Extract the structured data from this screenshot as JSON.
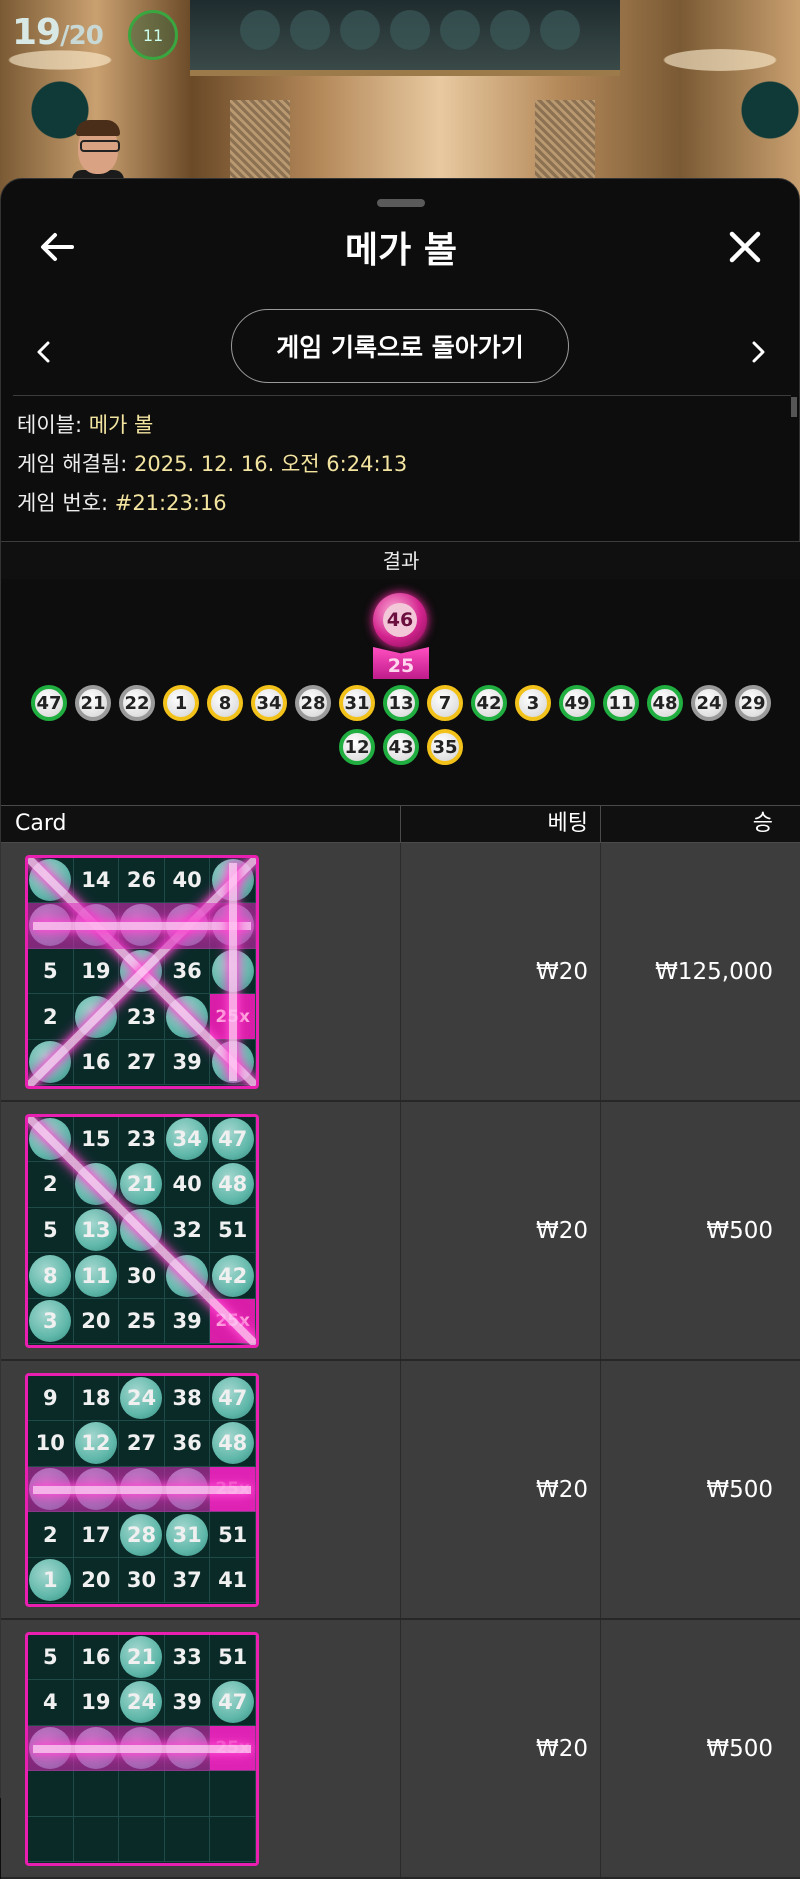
{
  "video": {
    "round_counter": "19",
    "round_total": "/20",
    "ring_value": "11"
  },
  "header": {
    "title": "메가 볼",
    "back_icon": "arrow-left-icon",
    "close_icon": "close-icon"
  },
  "nav": {
    "history_button": "게임 기록으로 돌아가기",
    "prev_icon": "chevron-left-icon",
    "next_icon": "chevron-right-icon"
  },
  "info": {
    "table_label": "테이블: ",
    "table_value": "메가 볼",
    "resolved_label": "게임 해결됨: ",
    "resolved_value": "2025. 12. 16. 오전 6:24:13",
    "game_no_label": "게임 번호: ",
    "game_no_value": "#21:23:16"
  },
  "result": {
    "header": "결과",
    "mega_ball": "46",
    "multiplier": "25",
    "balls": [
      {
        "n": "47",
        "c": "green"
      },
      {
        "n": "21",
        "c": "gray"
      },
      {
        "n": "22",
        "c": "gray"
      },
      {
        "n": "1",
        "c": "yellow"
      },
      {
        "n": "8",
        "c": "yellow"
      },
      {
        "n": "34",
        "c": "yellow"
      },
      {
        "n": "28",
        "c": "gray"
      },
      {
        "n": "31",
        "c": "yellow"
      },
      {
        "n": "13",
        "c": "green"
      },
      {
        "n": "7",
        "c": "yellow"
      },
      {
        "n": "42",
        "c": "green"
      },
      {
        "n": "3",
        "c": "yellow"
      },
      {
        "n": "49",
        "c": "green"
      },
      {
        "n": "11",
        "c": "green"
      },
      {
        "n": "48",
        "c": "green"
      },
      {
        "n": "24",
        "c": "gray"
      },
      {
        "n": "29",
        "c": "gray"
      },
      {
        "n": "12",
        "c": "green"
      },
      {
        "n": "43",
        "c": "green"
      },
      {
        "n": "35",
        "c": "yellow"
      }
    ]
  },
  "table": {
    "col_card": "Card",
    "col_bet": "베팅",
    "col_win": "승",
    "rows": [
      {
        "bet": "₩20",
        "win": "₩125,000",
        "cells": [
          {
            "n": "",
            "hit": true
          },
          {
            "n": "14"
          },
          {
            "n": "26"
          },
          {
            "n": "40"
          },
          {
            "n": "",
            "hit": true
          },
          {
            "n": "",
            "hit": true
          },
          {
            "n": "",
            "hit": true
          },
          {
            "n": "",
            "hit": true
          },
          {
            "n": "",
            "hit": true
          },
          {
            "n": "",
            "hit": true
          },
          {
            "n": "5"
          },
          {
            "n": "19"
          },
          {
            "n": "",
            "hit": true
          },
          {
            "n": "36"
          },
          {
            "n": "",
            "hit": true
          },
          {
            "n": "2"
          },
          {
            "n": "",
            "hit": true
          },
          {
            "n": "23"
          },
          {
            "n": "",
            "hit": true
          },
          {
            "n": "25x",
            "mega": true
          },
          {
            "n": "",
            "hit": true
          },
          {
            "n": "16"
          },
          {
            "n": "27"
          },
          {
            "n": "39"
          },
          {
            "n": "",
            "hit": true
          }
        ],
        "lines": [
          "diag1",
          "diag2",
          "row2",
          "col5"
        ]
      },
      {
        "bet": "₩20",
        "win": "₩500",
        "cells": [
          {
            "n": "",
            "hit": true
          },
          {
            "n": "15"
          },
          {
            "n": "23"
          },
          {
            "n": "34",
            "hit": true
          },
          {
            "n": "47",
            "hit": true
          },
          {
            "n": "2"
          },
          {
            "n": "",
            "hit": true
          },
          {
            "n": "21",
            "hit": true
          },
          {
            "n": "40"
          },
          {
            "n": "48",
            "hit": true
          },
          {
            "n": "5"
          },
          {
            "n": "13",
            "hit": true
          },
          {
            "n": "",
            "hit": true
          },
          {
            "n": "32"
          },
          {
            "n": "51"
          },
          {
            "n": "8",
            "hit": true
          },
          {
            "n": "11",
            "hit": true
          },
          {
            "n": "30"
          },
          {
            "n": "",
            "hit": true
          },
          {
            "n": "42",
            "hit": true
          },
          {
            "n": "3",
            "hit": true
          },
          {
            "n": "20"
          },
          {
            "n": "25"
          },
          {
            "n": "39"
          },
          {
            "n": "25x",
            "mega": true
          }
        ],
        "lines": [
          "diag1"
        ]
      },
      {
        "bet": "₩20",
        "win": "₩500",
        "cells": [
          {
            "n": "9"
          },
          {
            "n": "18"
          },
          {
            "n": "24",
            "hit": true
          },
          {
            "n": "38"
          },
          {
            "n": "47",
            "hit": true
          },
          {
            "n": "10"
          },
          {
            "n": "12",
            "hit": true
          },
          {
            "n": "27"
          },
          {
            "n": "36"
          },
          {
            "n": "48",
            "hit": true
          },
          {
            "n": "",
            "hit": true
          },
          {
            "n": "",
            "hit": true
          },
          {
            "n": "",
            "hit": true
          },
          {
            "n": "",
            "hit": true
          },
          {
            "n": "25x",
            "mega": true
          },
          {
            "n": "2"
          },
          {
            "n": "17"
          },
          {
            "n": "28",
            "hit": true
          },
          {
            "n": "31",
            "hit": true
          },
          {
            "n": "51"
          },
          {
            "n": "1",
            "hit": true
          },
          {
            "n": "20"
          },
          {
            "n": "30"
          },
          {
            "n": "37"
          },
          {
            "n": "41"
          }
        ],
        "lines": [
          "row3"
        ]
      },
      {
        "bet": "₩20",
        "win": "₩500",
        "cells": [
          {
            "n": "5"
          },
          {
            "n": "16"
          },
          {
            "n": "21",
            "hit": true
          },
          {
            "n": "33"
          },
          {
            "n": "51"
          },
          {
            "n": "4"
          },
          {
            "n": "19"
          },
          {
            "n": "24",
            "hit": true
          },
          {
            "n": "39"
          },
          {
            "n": "47",
            "hit": true
          },
          {
            "n": "",
            "hit": true
          },
          {
            "n": "",
            "hit": true
          },
          {
            "n": "",
            "hit": true
          },
          {
            "n": "",
            "hit": true
          },
          {
            "n": "25x",
            "mega": true
          },
          {
            "n": ""
          },
          {
            "n": ""
          },
          {
            "n": ""
          },
          {
            "n": ""
          },
          {
            "n": ""
          },
          {
            "n": ""
          },
          {
            "n": ""
          },
          {
            "n": ""
          },
          {
            "n": ""
          },
          {
            "n": ""
          }
        ],
        "lines": [
          "row3"
        ]
      }
    ]
  }
}
